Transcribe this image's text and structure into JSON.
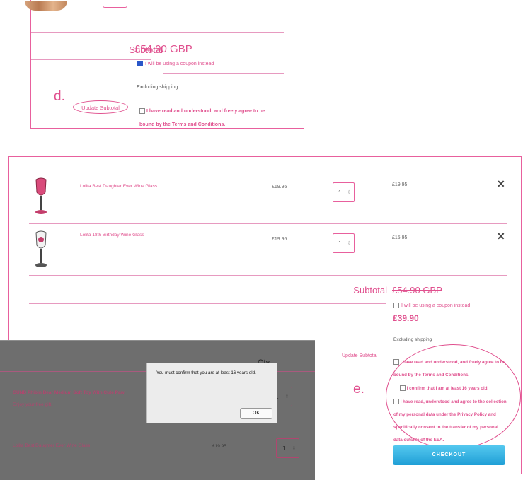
{
  "panel_d": {
    "annotation": "d.",
    "subtotal_label": "Subtotal",
    "subtotal_value": "£54.90 GBP",
    "coupon_label": "I will be using a coupon instead",
    "excluding_shipping": "Excluding shipping",
    "update_subtotal": "Update Subtotal",
    "terms": "I have read and understood, and freely agree to be bound by the Terms and Conditions."
  },
  "panel_e": {
    "annotation": "e.",
    "items": [
      {
        "name": "Lolita Best Daughter Ever Wine Glass",
        "price": "£19.95",
        "qty": "1",
        "total": "£19.95"
      },
      {
        "name": "Lolita 18th Birthday Wine Glass",
        "price": "£19.95",
        "qty": "1",
        "total": "£15.95"
      }
    ],
    "remove_symbol": "✕",
    "subtotal_label": "Subtotal",
    "old_price": "£54.90 GBP",
    "coupon_label": "I will be using a coupon instead",
    "new_price": "£39.90",
    "excluding_shipping": "Excluding shipping",
    "update_subtotal": "Update Subtotal",
    "terms_1": "I have read and understood, and freely agree to be bound by the Terms and Conditions.",
    "terms_2": "I confirm that I am at least 16 years old.",
    "terms_3": "I have read, understood and agree to the collection of my personal data under the Privacy Policy and specifically consent to the transfer of my personal data outside of the EEA.",
    "checkout": "CHECKOUT"
  },
  "overlay": {
    "col_qty": "Qty",
    "item_1_name": "GUND Phibin Bear Medium Soft Toy With Cute Paw",
    "item_1_note": "Enjoy your free gift.",
    "item_1_qty": "1",
    "item_2_name": "Lolita Best Daughter Ever Wine Glass",
    "item_2_price": "£19.95",
    "item_2_qty": "1",
    "dialog_message": "You must confirm that you are at least 16 years old.",
    "dialog_ok": "OK"
  },
  "colors": {
    "accent": "#e0508e",
    "checkout_blue": "#2aaee3"
  }
}
